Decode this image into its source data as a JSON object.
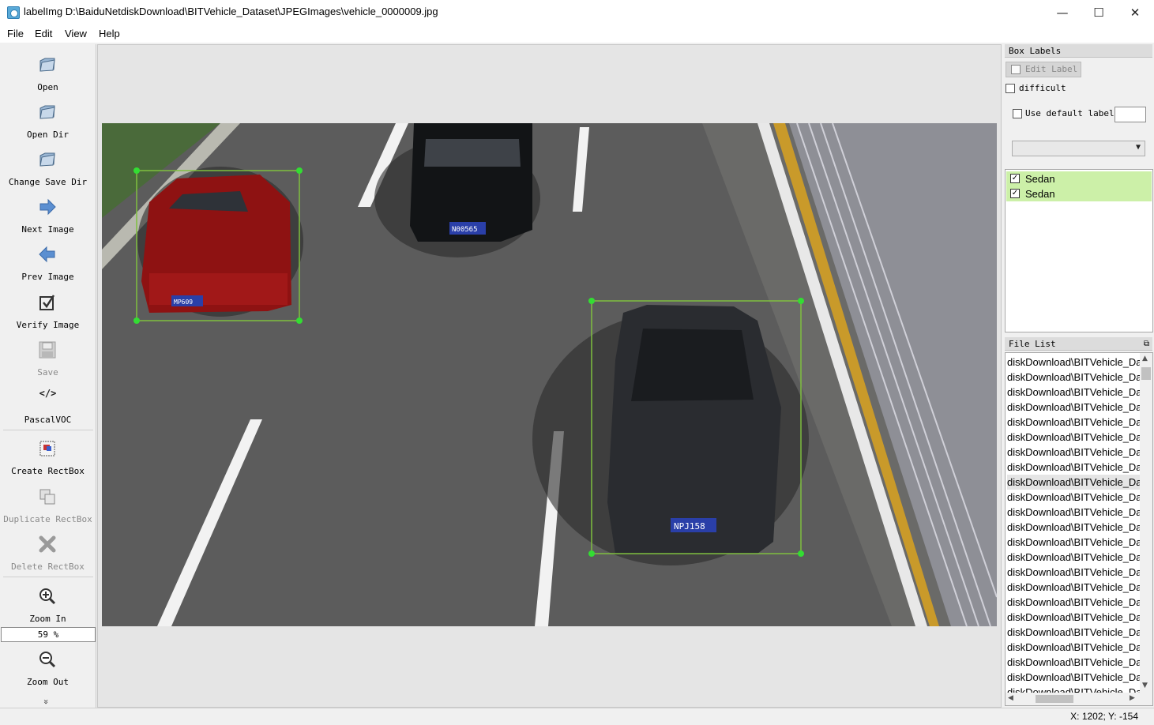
{
  "window": {
    "title": "labelImg D:\\BaiduNetdiskDownload\\BITVehicle_Dataset\\JPEGImages\\vehicle_0000009.jpg",
    "minimize": "—",
    "maximize": "☐",
    "close": "✕"
  },
  "menu": [
    "File",
    "Edit",
    "View",
    "Help"
  ],
  "toolbar": {
    "open": "Open",
    "open_dir": "Open Dir",
    "change_save_dir": "Change Save Dir",
    "next_image": "Next Image",
    "prev_image": "Prev Image",
    "verify_image": "Verify Image",
    "save": "Save",
    "format_icon": "</>",
    "format": "PascalVOC",
    "create_rectbox": "Create RectBox",
    "duplicate_rectbox": "Duplicate RectBox",
    "delete_rectbox": "Delete RectBox",
    "zoom_in": "Zoom In",
    "zoom_value": "59 %",
    "zoom_out": "Zoom Out",
    "more": "»"
  },
  "box_labels": {
    "title": "Box Labels",
    "edit_label": "Edit Label",
    "difficult": "difficult",
    "use_default_label": "Use default label",
    "default_label_value": "",
    "combo_value": "",
    "items": [
      {
        "label": "Sedan",
        "checked": "✓"
      },
      {
        "label": "Sedan",
        "checked": "✓"
      }
    ]
  },
  "file_list": {
    "title": "File List",
    "items": [
      "diskDownload\\BITVehicle_Da",
      "diskDownload\\BITVehicle_Da",
      "diskDownload\\BITVehicle_Da",
      "diskDownload\\BITVehicle_Da",
      "diskDownload\\BITVehicle_Da",
      "diskDownload\\BITVehicle_Da",
      "diskDownload\\BITVehicle_Da",
      "diskDownload\\BITVehicle_Da",
      "diskDownload\\BITVehicle_Da",
      "diskDownload\\BITVehicle_Da",
      "diskDownload\\BITVehicle_Da",
      "diskDownload\\BITVehicle_Da",
      "diskDownload\\BITVehicle_Da",
      "diskDownload\\BITVehicle_Da",
      "diskDownload\\BITVehicle_Da",
      "diskDownload\\BITVehicle_Da",
      "diskDownload\\BITVehicle_Da",
      "diskDownload\\BITVehicle_Da",
      "diskDownload\\BITVehicle_Da",
      "diskDownload\\BITVehicle_Da",
      "diskDownload\\BITVehicle_Da",
      "diskDownload\\BITVehicle_Da",
      "diskDownload\\BITVehicle_Da"
    ],
    "selected_index": 8
  },
  "image": {
    "plate_1": "MP609",
    "plate_2": "N00565",
    "plate_3": "NPJ158"
  },
  "status": {
    "coords": "X: 1202; Y: -154"
  },
  "colors": {
    "box": "#7fbf3f",
    "handle": "#33dd33",
    "label_highlight": "#ccf0a8"
  }
}
